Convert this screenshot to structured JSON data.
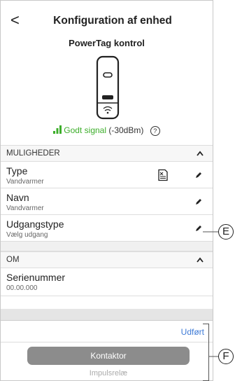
{
  "header": {
    "back_glyph": "<",
    "title": "Konfiguration af enhed",
    "subtitle": "PowerTag kontrol"
  },
  "signal": {
    "quality": "Godt signal",
    "value": "(-30dBm)",
    "help_glyph": "?",
    "color": "#3dae2b"
  },
  "muligheder": {
    "heading": "MULIGHEDER",
    "rows": [
      {
        "label": "Type",
        "value": "Vandvarmer"
      },
      {
        "label": "Navn",
        "value": "Vandvarmer"
      },
      {
        "label": "Udgangstype",
        "value": "Vælg udgang"
      }
    ]
  },
  "om": {
    "heading": "OM",
    "rows": [
      {
        "label": "Serienummer",
        "value": "00.00.000"
      }
    ]
  },
  "picker": {
    "done_label": "Udført",
    "selected": "Kontaktor",
    "other": "Impulsrelæ",
    "done_color": "#3d7ad6"
  },
  "callouts": {
    "e": "E",
    "f": "F"
  },
  "icons": {
    "edit": "pencil-icon",
    "document": "document-icon",
    "chevron": "chevron-up-icon"
  }
}
